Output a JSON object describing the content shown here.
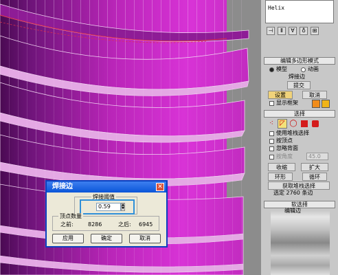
{
  "panel": {
    "list_item": "Helix",
    "edit_poly_mode": {
      "title": "编辑多边形模式",
      "model_label": "模型",
      "animate_label": "动画",
      "weld_edge_label": "焊接边",
      "commit_label": "提交",
      "settings_label": "设置",
      "cancel_label": "取消",
      "show_cage_label": "显示框架"
    },
    "selection": {
      "title": "选择",
      "use_stack_label": "使用堆栈选择",
      "by_vertex_label": "按顶点",
      "ignore_backfacing_label": "忽略背面",
      "by_angle_label": "按角度",
      "by_angle_value": "45.0",
      "shrink_label": "收缩",
      "grow_label": "扩大",
      "ring_label": "环形",
      "loop_label": "循环",
      "get_stack_label": "获取堆栈选择",
      "status": "选定 2760 条边"
    },
    "soft_selection": {
      "title": "软选择",
      "edit_edges_label": "编辑边"
    }
  },
  "dialog": {
    "title": "焊接边",
    "threshold_group": "焊接阈值",
    "threshold_value": "0.59",
    "vertex_count_group": "顶点数量",
    "before_label": "之前:",
    "before_value": "8286",
    "after_label": "之后:",
    "after_value": "6945",
    "apply_label": "应用",
    "ok_label": "确定",
    "cancel_label": "取消",
    "close_glyph": "✕"
  },
  "colors": {
    "mesh_light": "#c72ac7",
    "mesh_dark": "#5a0e63",
    "panel_bg": "#c8c8c8",
    "settings_button": "#f0d27a",
    "highlight_blue": "#2f8fd8"
  },
  "icons": {
    "close": "close-icon",
    "spinner": "spinner-arrows-icon",
    "vertex": "vertex-icon",
    "edge": "edge-icon",
    "border": "border-icon",
    "polygon": "polygon-icon",
    "element": "element-icon"
  }
}
